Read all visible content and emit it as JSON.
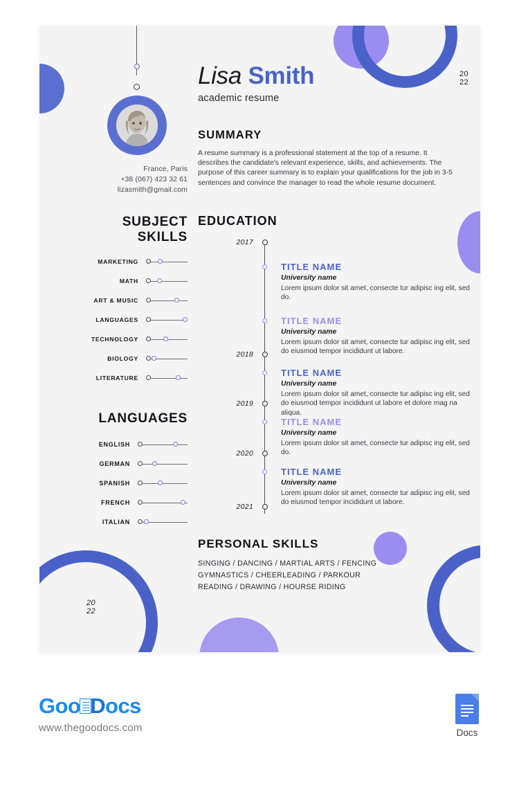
{
  "document": {
    "name_first": "Lisa",
    "name_last": "Smith",
    "subtitle": "academic resume",
    "year_top": [
      "20",
      "22"
    ],
    "year_bottom": [
      "20",
      "22"
    ]
  },
  "contact": {
    "location": "France, Paris",
    "phone": "+38 (067) 423 32 61",
    "email": "lizasmith@gmail.com"
  },
  "summary": {
    "heading": "SUMMARY",
    "body": "A resume summary is a professional statement at the top of a resume. It describes the candidate's relevant experience, skills, and achievements. The purpose of this career summary is to explain your qualifications for the job in 3-5 sentences and convince the manager to read the whole resume document."
  },
  "subject_skills": {
    "heading_line1": "SUBJECT",
    "heading_line2": "SKILLS",
    "items": [
      {
        "label": "MARKETING",
        "level": 33
      },
      {
        "label": "MATH",
        "level": 30
      },
      {
        "label": "ART & MUSIC",
        "level": 78
      },
      {
        "label": "LANGUAGES",
        "level": 100
      },
      {
        "label": "TECHNOLOGY",
        "level": 48
      },
      {
        "label": "BIOLOGY",
        "level": 16
      },
      {
        "label": "LITERATURE",
        "level": 82
      }
    ]
  },
  "languages": {
    "heading": "LANGUAGES",
    "items": [
      {
        "label": "ENGLISH",
        "level": 78
      },
      {
        "label": "GERMAN",
        "level": 33
      },
      {
        "label": "SPANISH",
        "level": 45
      },
      {
        "label": "FRENCH",
        "level": 95
      },
      {
        "label": "ITALIAN",
        "level": 14
      }
    ]
  },
  "education": {
    "heading": "EDUCATION",
    "years": [
      "2017",
      "2018",
      "2019",
      "2020",
      "2021"
    ],
    "entries": [
      {
        "title": "TITLE NAME",
        "title_color": "blue",
        "university": "University name",
        "description": "Lorem ipsum dolor sit amet, consecte tur adipisc ing elit, sed do."
      },
      {
        "title": "TITLE NAME",
        "title_color": "purple",
        "university": "University name",
        "description": "Lorem ipsum dolor sit amet, consecte tur adipisc ing elit, sed do eiusmod tempor incididunt ut labore."
      },
      {
        "title": "TITLE NAME",
        "title_color": "blue",
        "university": "University name",
        "description": "Lorem ipsum dolor sit amet, consecte tur adipisc ing elit, sed do eiusmod tempor incididunt ut labore et dolore mag na aliqua."
      },
      {
        "title": "TITLE NAME",
        "title_color": "purple",
        "university": "University name",
        "description": "Lorem ipsum dolor sit amet, consecte tur adipisc ing elit, sed do."
      },
      {
        "title": "TITLE NAME",
        "title_color": "blue",
        "university": "University name",
        "description": "Lorem ipsum dolor sit amet, consecte tur adipisc ing elit, sed do eiusmod tempor incididunt ut labore."
      }
    ]
  },
  "personal_skills": {
    "heading": "PERSONAL SKILLS",
    "lines": [
      "SINGING / DANCING / MARTIAL ARTS / FENCING",
      "GYMNASTICS /  CHEERLEADING / PARKOUR",
      "READING /  DRAWING / HOURSE RIDING"
    ]
  },
  "footer": {
    "brand_goo": "Goo",
    "brand_d": "D",
    "brand_ocs": "ocs",
    "url": "www.thegoodocs.com",
    "docs_label": "Docs"
  },
  "colors": {
    "blue": "#4a62c8",
    "blue_mid": "#5b6fd0",
    "purple": "#9b8df0",
    "page_bg": "#f4f4f5",
    "brand_blue": "#1a8cf0"
  }
}
